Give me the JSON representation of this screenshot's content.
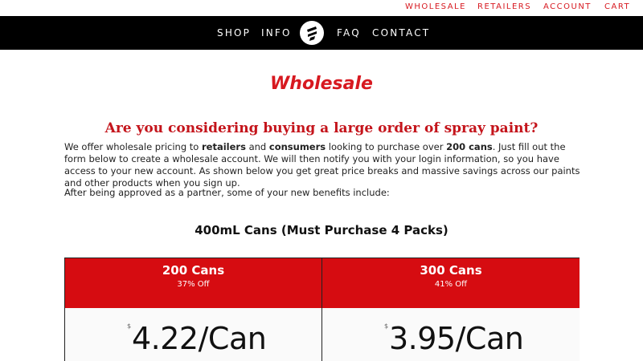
{
  "utility_nav": {
    "wholesale": "WHOLESALE",
    "retailers": "RETAILERS",
    "account": "ACCOUNT",
    "cart": "CART"
  },
  "main_nav": {
    "shop": "SHOP",
    "info": "INFO",
    "faq": "FAQ",
    "contact": "CONTACT",
    "logo_icon": "spray-can-logo-icon"
  },
  "page": {
    "title": "Wholesale",
    "subtitle": "Are you considering buying a large order of spray paint?",
    "intro": {
      "part1": "We offer wholesale pricing to ",
      "bold1": "retailers",
      "part2": " and ",
      "bold2": "consumers",
      "part3": " looking to purchase over ",
      "bold3": "200 cans",
      "part4": ". Just fill out the form below to create a wholesale account. We will then notify you with your login information, so you have access to your new account. As shown below you get great price breaks and massive savings across our paints and other products when you sign up."
    },
    "benefits_intro": "After being approved as a partner, some of your new benefits include:"
  },
  "pricing": {
    "section_title": "400mL Cans (Must Purchase 4 Packs)",
    "tiers": [
      {
        "quantity": "200 Cans",
        "discount": "37% Off",
        "currency": "$",
        "price": "4.22/Can"
      },
      {
        "quantity": "300 Cans",
        "discount": "41% Off",
        "currency": "$",
        "price": "3.95/Can"
      }
    ]
  },
  "colors": {
    "accent_red": "#d71920",
    "header_red": "#d60c11",
    "nav_black": "#000000"
  }
}
